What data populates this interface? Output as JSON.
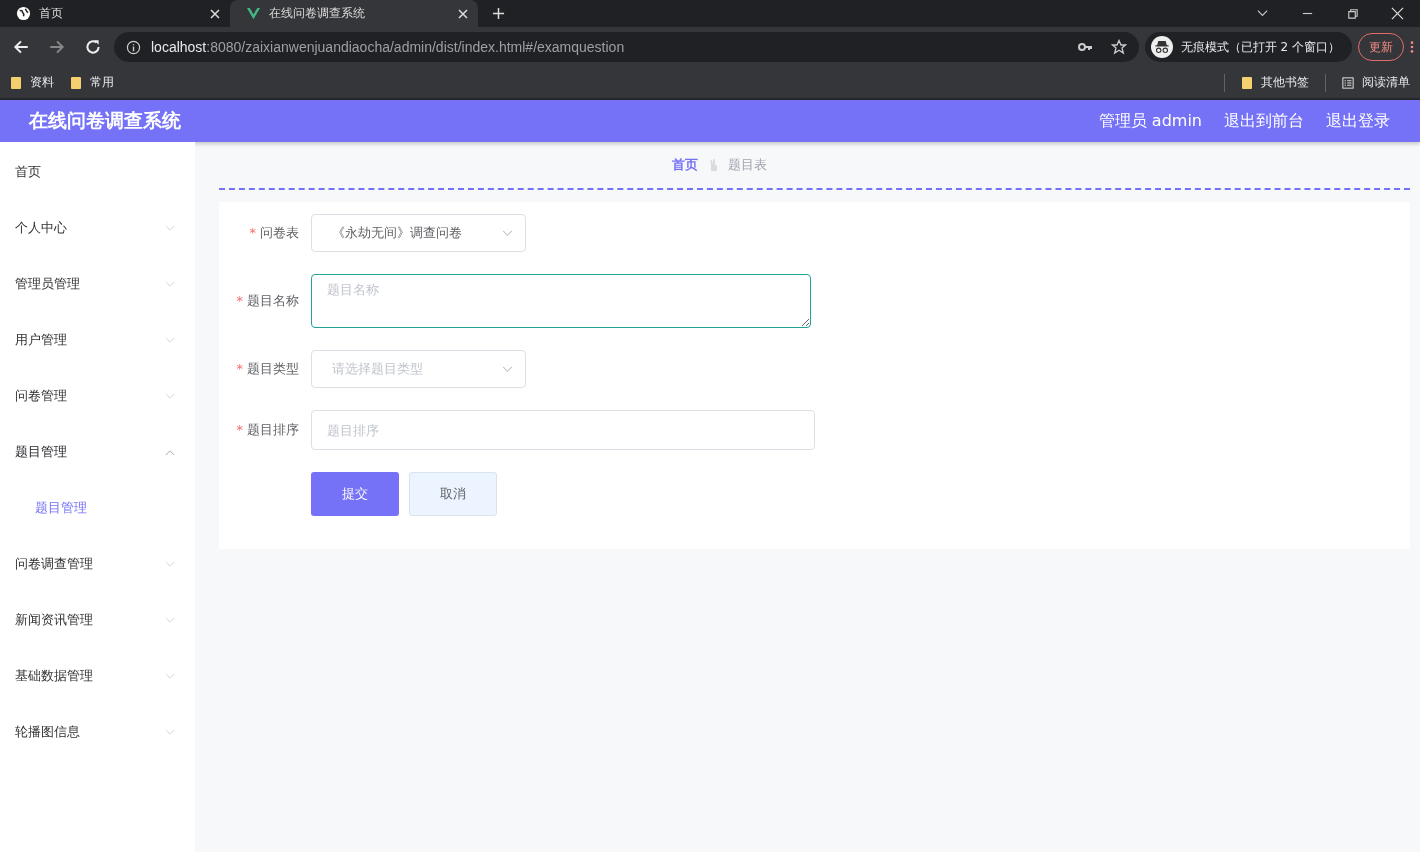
{
  "browser": {
    "tabs": [
      {
        "title": "首页",
        "selected": false
      },
      {
        "title": "在线问卷调查系统",
        "selected": true
      }
    ],
    "url_host": "localhost",
    "url_rest": ":8080/zaixianwenjuandiaocha/admin/dist/index.html#/examquestion",
    "profile_label": "无痕模式（已打开 2 个窗口）",
    "update_button": "更新",
    "bookmarks": [
      "资料",
      "常用"
    ],
    "other_bookmarks": "其他书签",
    "reading_list": "阅读清单"
  },
  "header": {
    "title": "在线问卷调查系统",
    "links": [
      "管理员 admin",
      "退出到前台",
      "退出登录"
    ]
  },
  "sidebar": {
    "items": [
      {
        "label": "首页",
        "kind": "link"
      },
      {
        "label": "个人中心",
        "kind": "group",
        "expanded": false
      },
      {
        "label": "管理员管理",
        "kind": "group",
        "expanded": false
      },
      {
        "label": "用户管理",
        "kind": "group",
        "expanded": false
      },
      {
        "label": "问卷管理",
        "kind": "group",
        "expanded": false
      },
      {
        "label": "题目管理",
        "kind": "group",
        "expanded": true,
        "children": [
          {
            "label": "题目管理",
            "selected": true
          }
        ]
      },
      {
        "label": "问卷调查管理",
        "kind": "group",
        "expanded": false
      },
      {
        "label": "新闻资讯管理",
        "kind": "group",
        "expanded": false
      },
      {
        "label": "基础数据管理",
        "kind": "group",
        "expanded": false
      },
      {
        "label": "轮播图信息",
        "kind": "group",
        "expanded": false
      }
    ]
  },
  "breadcrumb": [
    "首页",
    "题目表"
  ],
  "form": {
    "fields": [
      {
        "label": "问卷表",
        "kind": "select",
        "required_mark": "*",
        "value": "《永劫无间》调查问卷"
      },
      {
        "label": "题目名称",
        "kind": "textarea",
        "required_mark": "*",
        "placeholder": "题目名称",
        "focused": true
      },
      {
        "label": "题目类型",
        "kind": "select",
        "required_mark": "*",
        "placeholder": "请选择题目类型"
      },
      {
        "label": "题目排序",
        "kind": "input",
        "required_mark": "*",
        "placeholder": "题目排序"
      }
    ],
    "buttons": [
      {
        "label": "提交",
        "kind": "primary"
      },
      {
        "label": "取消",
        "kind": "default"
      }
    ]
  }
}
